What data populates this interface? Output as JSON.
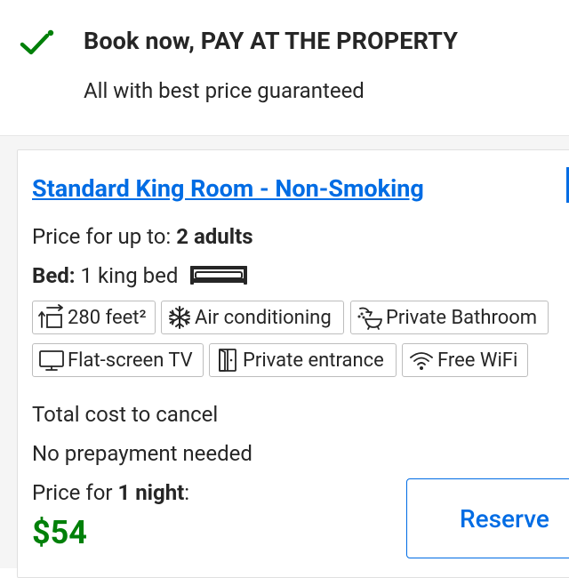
{
  "banner": {
    "title": "Book now, PAY AT THE PROPERTY",
    "subtitle": "All with best price guaranteed",
    "check_color": "#008009",
    "icon": "checkmark-icon"
  },
  "room": {
    "title": "Standard King Room - Non-Smoking",
    "price_for_label": "Price for up to:",
    "price_for_value": "2 adults",
    "bed_label": "Bed:",
    "bed_value": "1 king bed",
    "bed_icon": "king-bed-icon"
  },
  "facilities": [
    {
      "label": "280 feet²",
      "icon": "room-size-icon"
    },
    {
      "label": "Air conditioning",
      "icon": "snowflake-icon"
    },
    {
      "label": "Private Bathroom",
      "icon": "bath-shower-icon"
    },
    {
      "label": "Flat-screen TV",
      "icon": "tv-icon"
    },
    {
      "label": "Private entrance",
      "icon": "door-icon"
    },
    {
      "label": "Free WiFi",
      "icon": "wifi-icon"
    }
  ],
  "policies": {
    "cancel": "Total cost to cancel",
    "prepayment": "No prepayment needed"
  },
  "pricing": {
    "label_prefix": "Price for",
    "nights": "1 night",
    "label_suffix": ":",
    "amount": "$54",
    "amount_color": "#008009"
  },
  "actions": {
    "reserve_label": "Reserve",
    "accent_color": "#006ce4"
  }
}
